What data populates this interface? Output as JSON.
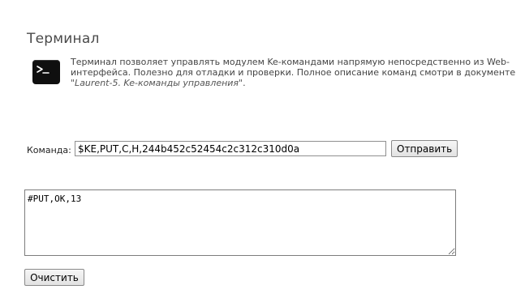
{
  "page": {
    "title": "Терминал"
  },
  "intro": {
    "icon": "terminal-icon",
    "text": "Терминал позволяет управлять модулем Ke-командами напрямую непосредственно из Web-интерфейса. Полезно для отладки и проверки. Полное описание команд смотри в документе ",
    "doc_ref": "\"Laurent-5. Ke-команды управления\"",
    "text_end": "."
  },
  "command": {
    "label": "Команда:",
    "value": "$KE,PUT,C,H,244b452c52454c2c312c310d0a",
    "send_label": "Отправить"
  },
  "output": {
    "text": "#PUT,OK,13"
  },
  "actions": {
    "clear_label": "Очистить"
  }
}
